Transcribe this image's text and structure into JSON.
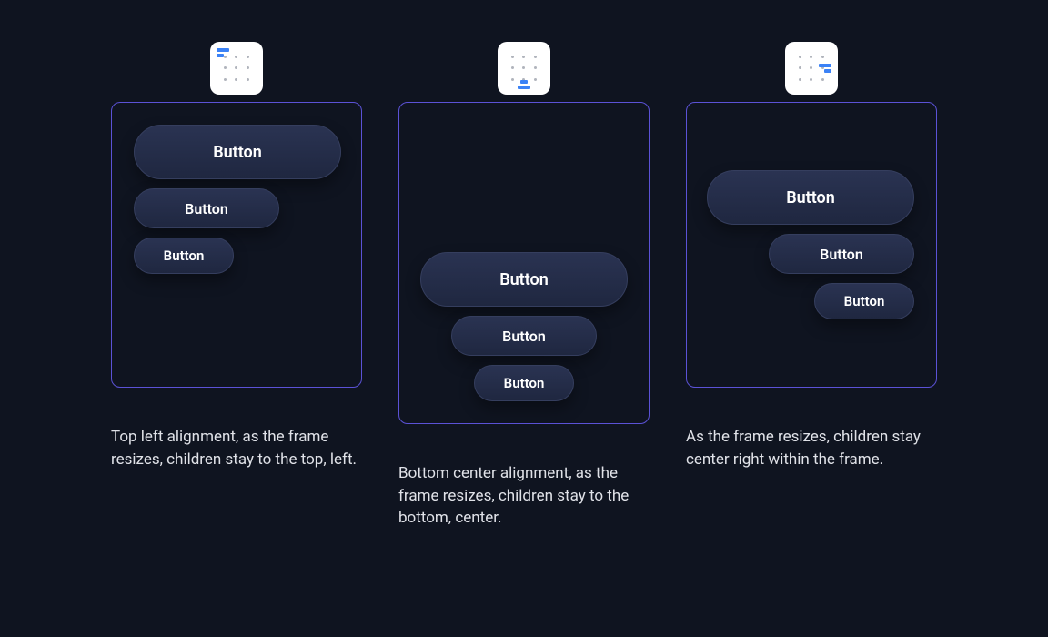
{
  "examples": [
    {
      "id": "top-left",
      "icon_position": "top-left",
      "caption": "Top left alignment, as the frame resizes, children stay to the top, left.",
      "buttons": [
        "Button",
        "Button",
        "Button"
      ]
    },
    {
      "id": "bottom-center",
      "icon_position": "bottom-center",
      "caption": "Bottom center alignment, as the frame resizes, children stay to the bottom, center.",
      "buttons": [
        "Button",
        "Button",
        "Button"
      ]
    },
    {
      "id": "center-right",
      "icon_position": "center-right",
      "caption": "As the frame resizes, children stay center right within the frame.",
      "buttons": [
        "Button",
        "Button",
        "Button"
      ]
    }
  ]
}
